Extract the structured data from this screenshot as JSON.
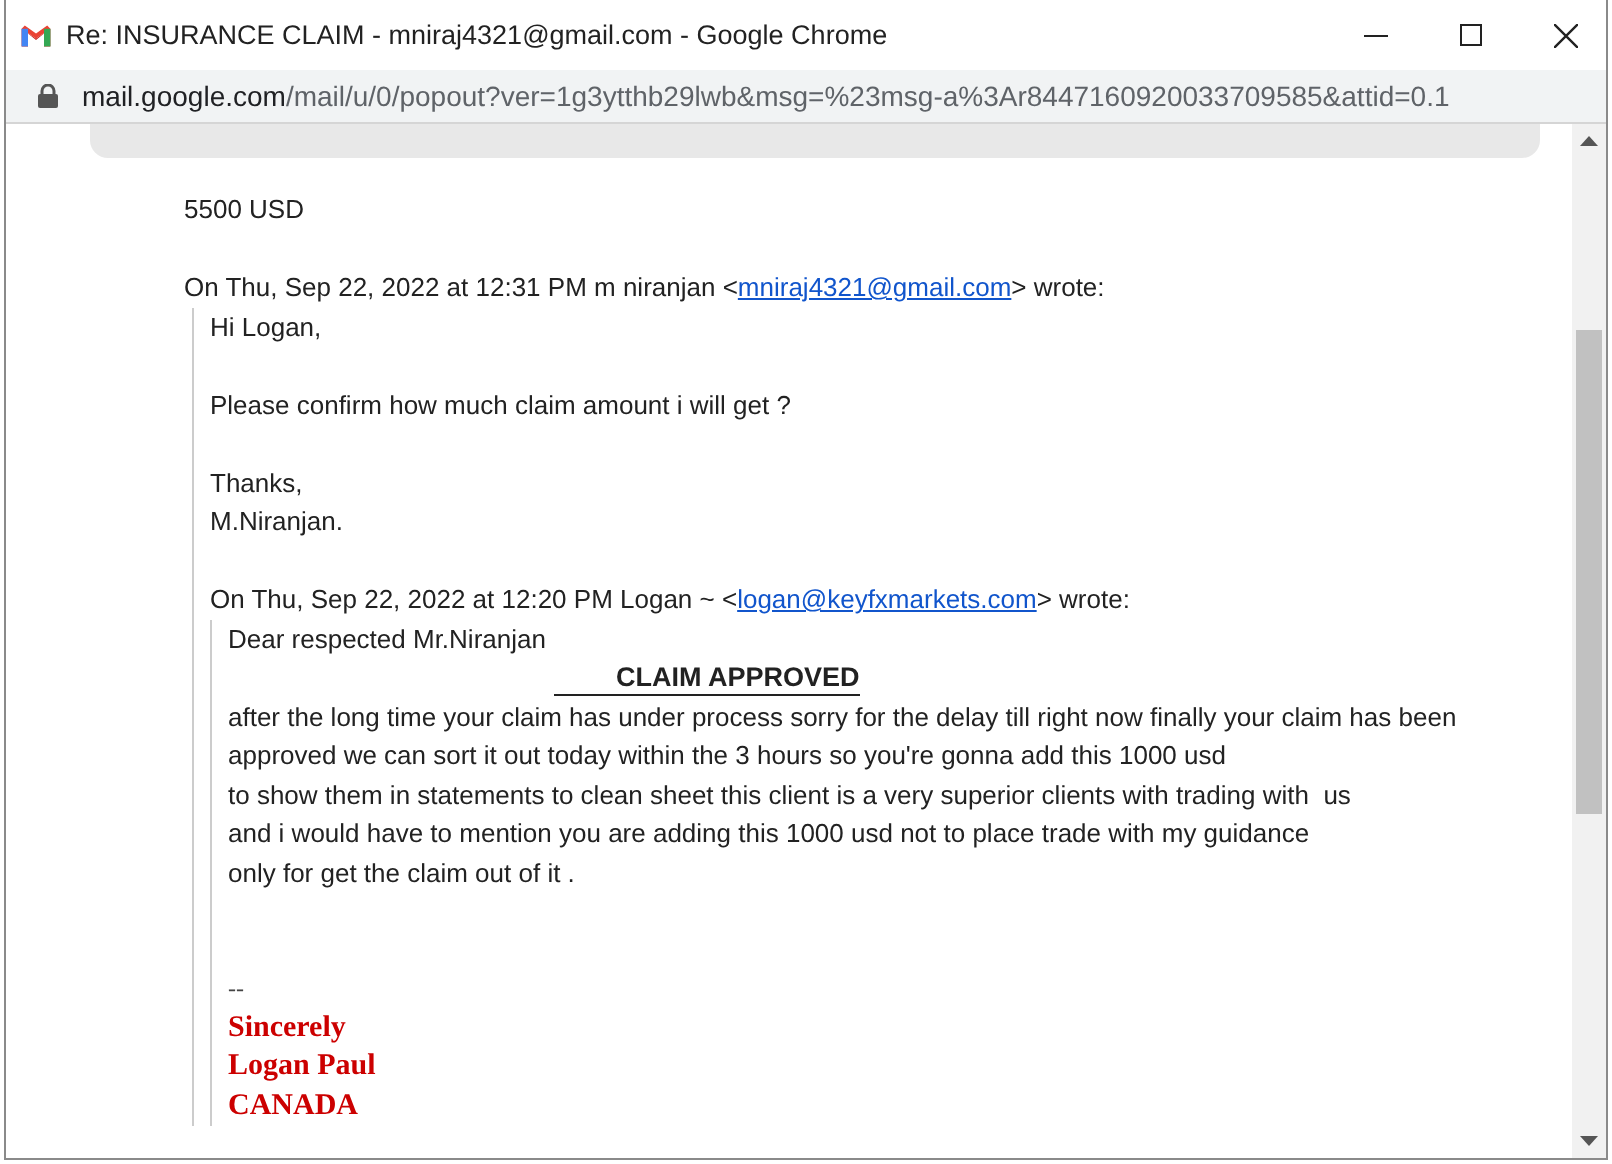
{
  "window": {
    "title": "Re: INSURANCE CLAIM - mniraj4321@gmail.com - Google Chrome"
  },
  "address_bar": {
    "host": "mail.google.com",
    "path": "/mail/u/0/popout?ver=1g3ytthb29lwb&msg=%23msg-a%3Ar8447160920033709585&attid=0.1"
  },
  "message": {
    "paragraphs": [
      [
        "5500 USD"
      ]
    ],
    "quote": {
      "header_prefix": "On Thu, Sep 22, 2022 at 12:31 PM m niranjan <",
      "header_link": "mniraj4321@gmail.com",
      "header_suffix": "> wrote:",
      "paragraphs": [
        [
          "Hi Logan,"
        ],
        [
          "Please confirm how much claim amount i will get ?"
        ],
        [
          "Thanks,",
          "M.Niranjan."
        ]
      ],
      "quote": {
        "header_prefix": "On Thu, Sep 22, 2022 at 12:20 PM Logan ~ <",
        "header_link": "logan@keyfxmarkets.com",
        "header_suffix": "> wrote:",
        "greeting": "Dear respected Mr.Niranjan",
        "heading": "CLAIM APPROVED",
        "lines": [
          "after the long time your claim has under process sorry for the delay till right now finally your claim has been",
          "approved we can sort it out today within the 3 hours so you're gonna add this 1000 usd",
          "to show them in statements to clean sheet this client is a very superior clients with trading with  us",
          "and i would have to mention you are adding this 1000 usd not to place trade with my guidance",
          "only for get the claim out of it ."
        ],
        "signature_separator": "--",
        "signature": [
          "Sincerely",
          "Logan Paul",
          "CANADA"
        ]
      }
    }
  }
}
